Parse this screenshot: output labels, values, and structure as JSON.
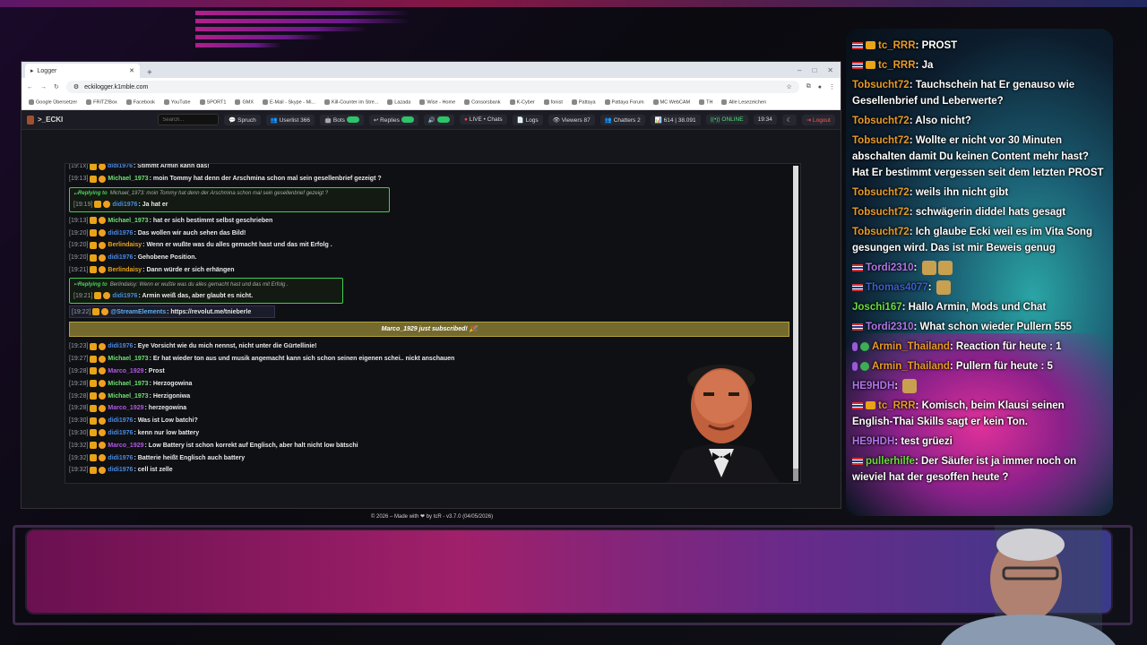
{
  "browser": {
    "tab_title": "Logger",
    "url": "eckilogger.k1mble.com",
    "bookmarks": [
      "Google Übersetzer",
      "FRITZ!Box",
      "Facebook",
      "YouTube",
      "SPORT1",
      "GMX",
      "E-Mail - Skype - Mi...",
      "Kill-Counter im Stre...",
      "Lazada",
      "Wise - Home",
      "Consorsbank",
      "K-Cyber",
      "fonist",
      "Pattaya",
      "Pattaya Forum",
      "MC WebCAM",
      "TH",
      "Alle Lesezeichen"
    ]
  },
  "app": {
    "brand": ">_ECKI",
    "search_placeholder": "Search...",
    "nav": {
      "spruch": "Spruch",
      "userlist": "Userlist 366",
      "bots": "Bots",
      "replies": "Replies",
      "live": "LIVE • Chats",
      "logs": "Logs",
      "viewers": "Viewers 87",
      "chatters": "Chatters 2",
      "counts": "614 | 38.091",
      "online": "ONLINE",
      "time": "19:34",
      "logout": "Logout"
    },
    "footer": "© 2026 – Made with ❤ by tcR - v3.7.0 (04/05/2026)"
  },
  "log": {
    "first_partial": {
      "ts": "[19:1x]",
      "user": "didi1976",
      "text": ": Stimmt Armin kann das!"
    },
    "rows_a": [
      {
        "ts": "[19:13]",
        "user": "Michael_1973",
        "color": "#6fe06f",
        "text": ": moin Tommy hat denn der Arschmina schon mal sein gesellenbrief gezeigt ?"
      }
    ],
    "reply1": {
      "label": "Replying to",
      "to": "Michael_1973: moin Tommy hat denn der Arschmina schon mal sein gesellenbrief gezeigt ?",
      "ts": "[19:19]",
      "user": "didi1976",
      "text": ": Ja hat er"
    },
    "rows_b": [
      {
        "ts": "[19:13]",
        "user": "Michael_1973",
        "color": "#6fe06f",
        "text": ": hat er sich bestimmt selbst geschrieben"
      },
      {
        "ts": "[19:20]",
        "user": "didi1976",
        "color": "#4a8ae0",
        "text": ": Das wollen wir auch sehen das Bild!"
      },
      {
        "ts": "[19:20]",
        "user": "Berlindaisy",
        "color": "#e8a317",
        "text": ": Wenn er wußte was du alles gemacht hast und das mit Erfolg ."
      },
      {
        "ts": "[19:20]",
        "user": "didi1976",
        "color": "#4a8ae0",
        "text": ": Gehobene Position."
      },
      {
        "ts": "[19:21]",
        "user": "Berlindaisy",
        "color": "#e8a317",
        "text": ": Dann würde er sich erhängen"
      }
    ],
    "reply2": {
      "label": "Replying to",
      "to": "Berlindaisy: Wenn er wußte was du alles gemacht hast und das mit Erfolg .",
      "ts": "[19:21]",
      "user": "didi1976",
      "text": ": Armin weiß das, aber glaubt es nicht."
    },
    "se_row": {
      "ts": "[19:22]",
      "user": "@StreamElements",
      "text": ": https://revolut.me/tnieberle"
    },
    "sub_banner": "Marco_1929 just subscribed! 🎉",
    "rows_c": [
      {
        "ts": "[19:23]",
        "user": "didi1976",
        "color": "#4a8ae0",
        "text": ": Eye Vorsicht wie du mich nennst, nicht unter die Gürtellinie!"
      },
      {
        "ts": "[19:27]",
        "user": "Michael_1973",
        "color": "#6fe06f",
        "text": ": Er hat wieder ton aus und musik angemacht kann sich schon seinen eigenen schei.. nickt anschauen"
      },
      {
        "ts": "[19:28]",
        "user": "Marco_1929",
        "color": "#b05ae0",
        "text": ": Prost"
      },
      {
        "ts": "[19:28]",
        "user": "Michael_1973",
        "color": "#6fe06f",
        "text": ": Herzogowina"
      },
      {
        "ts": "[19:28]",
        "user": "Michael_1973",
        "color": "#6fe06f",
        "text": ": Herzigoniwa"
      },
      {
        "ts": "[19:28]",
        "user": "Marco_1929",
        "color": "#b05ae0",
        "text": ": herzegowina"
      },
      {
        "ts": "[19:30]",
        "user": "didi1976",
        "color": "#4a8ae0",
        "text": ": Was ist Low batchi?"
      },
      {
        "ts": "[19:30]",
        "user": "didi1976",
        "color": "#4a8ae0",
        "text": ": kenn nur low battery"
      },
      {
        "ts": "[19:32]",
        "user": "Marco_1929",
        "color": "#b05ae0",
        "text": ": Low Battery ist schon korrekt auf Englisch, aber halt nicht low bätschi"
      },
      {
        "ts": "[19:32]",
        "user": "didi1976",
        "color": "#4a8ae0",
        "text": ": Batterie heißt Englisch auch battery"
      },
      {
        "ts": "[19:32]",
        "user": "didi1976",
        "color": "#4a8ae0",
        "text": ": cell ist zelle"
      }
    ]
  },
  "twitch_chat": [
    {
      "badge": "flag-crown",
      "name": "tc_RRR",
      "cls": "",
      "text": ": PROST"
    },
    {
      "badge": "flag-crown",
      "name": "tc_RRR",
      "cls": "",
      "text": ": Ja"
    },
    {
      "badge": "",
      "name": "Tobsucht72",
      "cls": "",
      "text": ": Tauchschein hat Er genauso wie Gesellenbrief und Leberwerte?"
    },
    {
      "badge": "",
      "name": "Tobsucht72",
      "cls": "",
      "text": ": Also nicht?"
    },
    {
      "badge": "",
      "name": "Tobsucht72",
      "cls": "",
      "text": ": Wollte er nicht vor 30 Minuten abschalten damit Du keinen Content mehr hast? Hat Er bestimmt vergessen seit dem letzten PROST"
    },
    {
      "badge": "",
      "name": "Tobsucht72",
      "cls": "",
      "text": ": weils ihn nicht gibt"
    },
    {
      "badge": "",
      "name": "Tobsucht72",
      "cls": "",
      "text": ": schwägerin diddel hats gesagt"
    },
    {
      "badge": "",
      "name": "Tobsucht72",
      "cls": "",
      "text": ": Ich glaube Ecki weil es im Vita Song gesungen wird. Das ist mir Beweis genug"
    },
    {
      "badge": "flag",
      "name": "Tordi2310",
      "cls": "v",
      "text": ": ",
      "emotes": 2
    },
    {
      "badge": "flag",
      "name": "Thomas4077",
      "cls": "b",
      "text": ": ",
      "emotes": 1
    },
    {
      "badge": "",
      "name": "Joschi167",
      "cls": "g",
      "text": ": Hallo Armin, Mods und Chat"
    },
    {
      "badge": "flag",
      "name": "Tordi2310",
      "cls": "v",
      "text": ": What schon wieder Pullern 555"
    },
    {
      "badge": "mic-check",
      "name": "Armin_Thailand",
      "cls": "",
      "text": ": Reaction für heute : 1"
    },
    {
      "badge": "mic-check",
      "name": "Armin_Thailand",
      "cls": "",
      "text": ": Pullern für heute : 5"
    },
    {
      "badge": "",
      "name": "HE9HDH",
      "cls": "v",
      "text": ": ",
      "emotes": 1
    },
    {
      "badge": "flag-crown",
      "name": "tc_RRR",
      "cls": "",
      "text": ": Komisch, beim Klausi seinen English-Thai Skills sagt er kein Ton."
    },
    {
      "badge": "",
      "name": "HE9HDH",
      "cls": "v",
      "text": ": test grüezi"
    },
    {
      "badge": "flag",
      "name": "pullerhilfe",
      "cls": "g",
      "text": ": Der Säufer ist ja immer noch on wieviel hat der gesoffen heute ?"
    }
  ]
}
